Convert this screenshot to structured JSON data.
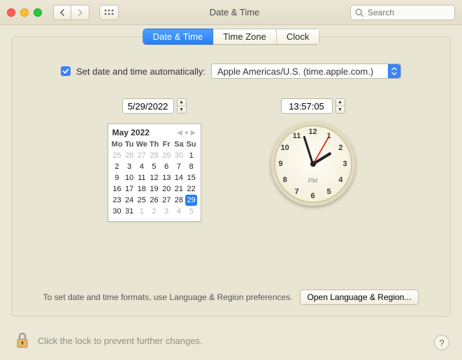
{
  "window": {
    "title": "Date & Time",
    "search_placeholder": "Search"
  },
  "tabs": {
    "date_time": "Date & Time",
    "time_zone": "Time Zone",
    "clock": "Clock"
  },
  "auto": {
    "checked": true,
    "label": "Set date and time automatically:",
    "server": "Apple Americas/U.S. (time.apple.com.)"
  },
  "date_field": "5/29/2022",
  "time_field": "13:57:05",
  "calendar": {
    "title": "May 2022",
    "dow": [
      "Mo",
      "Tu",
      "We",
      "Th",
      "Fr",
      "Sa",
      "Su"
    ],
    "weeks": [
      [
        {
          "n": 25,
          "dim": true
        },
        {
          "n": 26,
          "dim": true
        },
        {
          "n": 27,
          "dim": true
        },
        {
          "n": 28,
          "dim": true
        },
        {
          "n": 29,
          "dim": true
        },
        {
          "n": 30,
          "dim": true
        },
        {
          "n": 1
        }
      ],
      [
        {
          "n": 2
        },
        {
          "n": 3
        },
        {
          "n": 4
        },
        {
          "n": 5
        },
        {
          "n": 6
        },
        {
          "n": 7
        },
        {
          "n": 8
        }
      ],
      [
        {
          "n": 9
        },
        {
          "n": 10
        },
        {
          "n": 11
        },
        {
          "n": 12
        },
        {
          "n": 13
        },
        {
          "n": 14
        },
        {
          "n": 15
        }
      ],
      [
        {
          "n": 16
        },
        {
          "n": 17
        },
        {
          "n": 18
        },
        {
          "n": 19
        },
        {
          "n": 20
        },
        {
          "n": 21
        },
        {
          "n": 22
        }
      ],
      [
        {
          "n": 23
        },
        {
          "n": 24
        },
        {
          "n": 25
        },
        {
          "n": 26
        },
        {
          "n": 27
        },
        {
          "n": 28
        },
        {
          "n": 29,
          "sel": true
        }
      ],
      [
        {
          "n": 30
        },
        {
          "n": 31
        },
        {
          "n": 1,
          "dim": true
        },
        {
          "n": 2,
          "dim": true
        },
        {
          "n": 3,
          "dim": true
        },
        {
          "n": 4,
          "dim": true
        },
        {
          "n": 5,
          "dim": true
        }
      ]
    ]
  },
  "clock": {
    "ampm": "PM",
    "hours": 13,
    "minutes": 57,
    "seconds": 5
  },
  "footer": {
    "hint": "To set date and time formats, use Language & Region preferences.",
    "open_button": "Open Language & Region..."
  },
  "lock_hint": "Click the lock to prevent further changes.",
  "help": "?"
}
